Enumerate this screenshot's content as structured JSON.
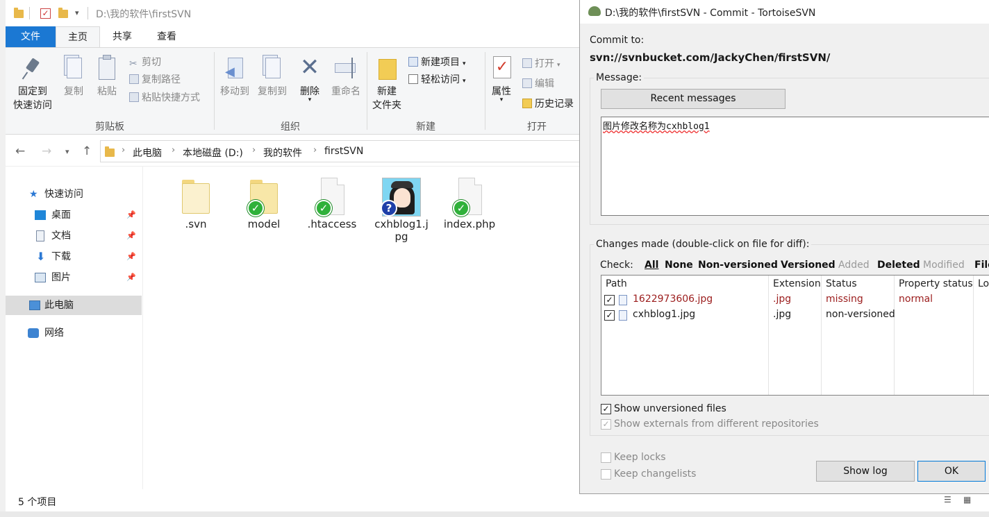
{
  "explorer": {
    "title": "D:\\我的软件\\firstSVN",
    "menu": {
      "file": "文件",
      "home": "主页",
      "share": "共享",
      "view": "查看"
    },
    "ribbon": {
      "clipboard": {
        "label": "剪贴板",
        "pin_line1": "固定到",
        "pin_line2": "快速访问",
        "copy": "复制",
        "paste": "粘贴",
        "cut": "剪切",
        "copy_path": "复制路径",
        "paste_shortcut": "粘贴快捷方式"
      },
      "organize": {
        "label": "组织",
        "move_to": "移动到",
        "copy_to": "复制到",
        "delete": "删除",
        "rename": "重命名"
      },
      "new": {
        "label": "新建",
        "new_folder_line1": "新建",
        "new_folder_line2": "文件夹",
        "new_item": "新建项目",
        "easy_access": "轻松访问"
      },
      "open": {
        "label": "打开",
        "properties": "属性",
        "open": "打开",
        "edit": "编辑",
        "history": "历史记录"
      }
    },
    "breadcrumb": [
      "此电脑",
      "本地磁盘 (D:)",
      "我的软件",
      "firstSVN"
    ],
    "nav": {
      "quick_access": "快速访问",
      "desktop": "桌面",
      "documents": "文档",
      "downloads": "下载",
      "pictures": "图片",
      "this_pc": "此电脑",
      "network": "网络"
    },
    "files": [
      {
        "name": ".svn"
      },
      {
        "name": "model"
      },
      {
        "name": ".htaccess"
      },
      {
        "name_line1": "cxhblog1.j",
        "name_line2": "pg"
      },
      {
        "name": "index.php"
      }
    ],
    "status": "5 个项目"
  },
  "dialog": {
    "title": "D:\\我的软件\\firstSVN - Commit - TortoiseSVN",
    "commit_to_label": "Commit to:",
    "commit_url": "svn://svnbucket.com/JackyChen/firstSVN/",
    "message_label": "Message:",
    "recent_messages": "Recent messages",
    "message_text": "图片修改名称为cxhblog1",
    "changes_label": "Changes made (double-click on file for diff):",
    "check_label": "Check:",
    "check_links": {
      "all": "All",
      "none": "None",
      "non_versioned": "Non-versioned",
      "versioned": "Versioned",
      "added": "Added",
      "deleted": "Deleted",
      "modified": "Modified",
      "files": "File"
    },
    "columns": {
      "path": "Path",
      "extension": "Extension",
      "status": "Status",
      "property_status": "Property status",
      "lock": "Loc"
    },
    "rows": [
      {
        "path": "1622973606.jpg",
        "extension": ".jpg",
        "status": "missing",
        "property_status": "normal"
      },
      {
        "path": "cxhblog1.jpg",
        "extension": ".jpg",
        "status": "non-versioned",
        "property_status": ""
      }
    ],
    "show_unversioned": "Show unversioned files",
    "show_externals": "Show externals from different repositories",
    "keep_locks": "Keep locks",
    "keep_changelists": "Keep changelists",
    "show_log": "Show log",
    "ok": "OK"
  }
}
